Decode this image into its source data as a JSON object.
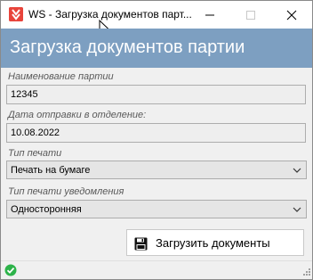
{
  "window": {
    "title": "WS - Загрузка документов парт...",
    "app_icon": "app-logo-icon",
    "controls": [
      "minimize-icon",
      "maximize-icon",
      "close-icon"
    ]
  },
  "header": {
    "title": "Загрузка документов партии",
    "background": "#7d9fc1"
  },
  "form": {
    "batch_name_label": "Наименование партии",
    "batch_name_value": "12345",
    "send_date_label": "Дата отправки в отделение:",
    "send_date_value": "10.08.2022",
    "print_type_label": "Тип печати",
    "print_type_value": "Печать на бумаге",
    "notice_print_type_label": "Тип печати уведомления",
    "notice_print_type_value": "Односторонняя"
  },
  "actions": {
    "upload_label": "Загрузить документы",
    "upload_icon": "floppy-disk-icon"
  },
  "status": {
    "icon": "check-circle-icon",
    "color": "#2db34a"
  }
}
